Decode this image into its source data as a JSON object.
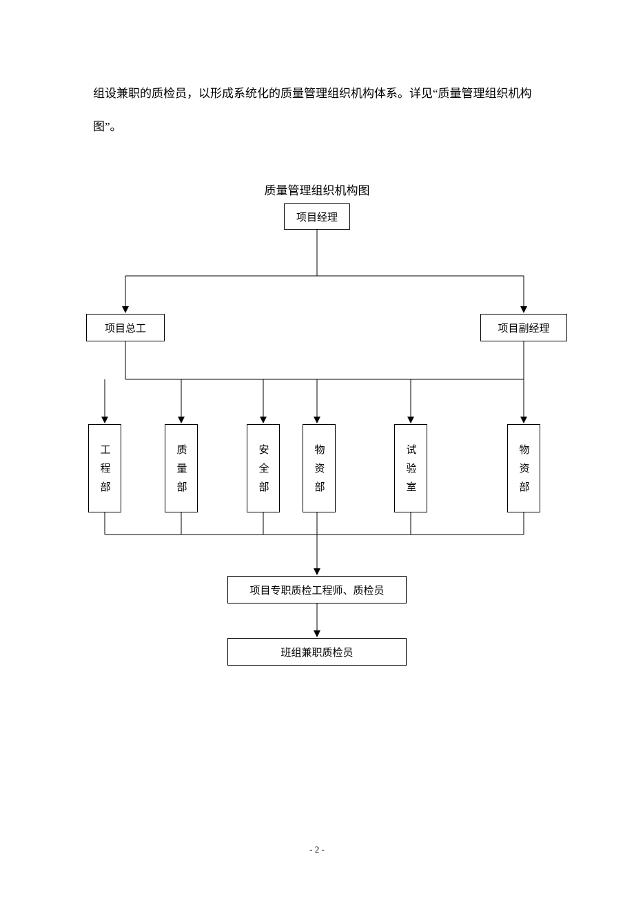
{
  "paragraph": "组设兼职的质检员，以形成系统化的质量管理组织机构体系。详见“质量管理组织机构图”。",
  "chart_title": "质量管理组织机构图",
  "chart_data": {
    "type": "org_tree",
    "title": "质量管理组织机构图",
    "nodes": [
      {
        "id": "pm",
        "label": "项目经理",
        "level": 0
      },
      {
        "id": "eng",
        "label": "项目总工",
        "level": 1
      },
      {
        "id": "dpm",
        "label": "项目副经理",
        "level": 1
      },
      {
        "id": "d1",
        "label": "工程部",
        "level": 2
      },
      {
        "id": "d2",
        "label": "质量部",
        "level": 2
      },
      {
        "id": "d3",
        "label": "安全部",
        "level": 2
      },
      {
        "id": "d4",
        "label": "物资部",
        "level": 2
      },
      {
        "id": "d5",
        "label": "试验室",
        "level": 2
      },
      {
        "id": "d6",
        "label": "物资部",
        "level": 2
      },
      {
        "id": "qc1",
        "label": "项目专职质检工程师、质检员",
        "level": 3
      },
      {
        "id": "qc2",
        "label": "班组兼职质检员",
        "level": 4
      }
    ],
    "edges": [
      [
        "pm",
        "eng"
      ],
      [
        "pm",
        "dpm"
      ],
      [
        "eng",
        "d1"
      ],
      [
        "eng",
        "d2"
      ],
      [
        "eng",
        "d3"
      ],
      [
        "eng",
        "d4"
      ],
      [
        "eng",
        "d5"
      ],
      [
        "eng",
        "d6"
      ],
      [
        "dpm",
        "d1"
      ],
      [
        "dpm",
        "d2"
      ],
      [
        "dpm",
        "d3"
      ],
      [
        "dpm",
        "d4"
      ],
      [
        "dpm",
        "d5"
      ],
      [
        "dpm",
        "d6"
      ],
      [
        "d1",
        "qc1"
      ],
      [
        "d2",
        "qc1"
      ],
      [
        "d3",
        "qc1"
      ],
      [
        "d4",
        "qc1"
      ],
      [
        "d5",
        "qc1"
      ],
      [
        "d6",
        "qc1"
      ],
      [
        "qc1",
        "qc2"
      ]
    ]
  },
  "nodes": {
    "pm": "项目经理",
    "eng": "项目总工",
    "dpm": "项目副经理",
    "d1": "工程部",
    "d2": "质量部",
    "d3": "安全部",
    "d4": "物资部",
    "d5": "试验室",
    "d6": "物资部",
    "qc1": "项目专职质检工程师、质检员",
    "qc2": "班组兼职质检员"
  },
  "page_number": "- 2 -"
}
